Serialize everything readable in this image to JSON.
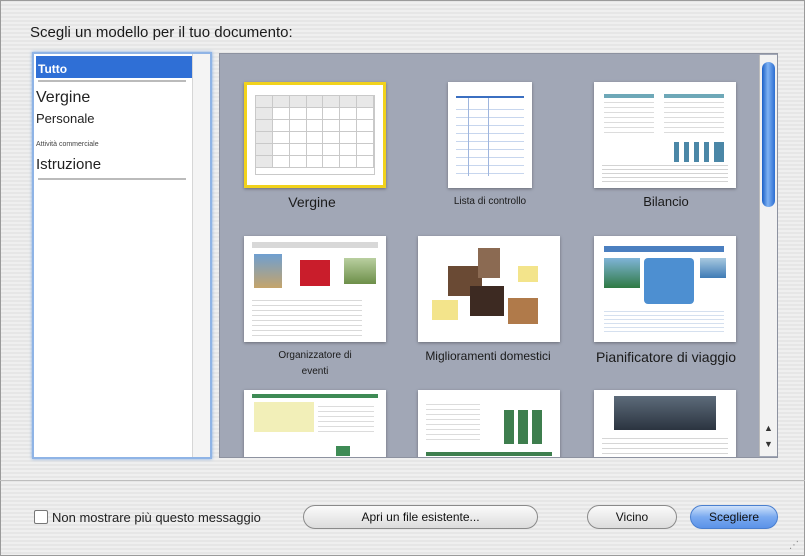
{
  "dialog": {
    "prompt": "Scegli un modello per il tuo documento:"
  },
  "sidebar": {
    "items": [
      {
        "label": "Tutto"
      },
      {
        "label": "Vergine"
      },
      {
        "label": "Personale"
      },
      {
        "label": "Attività commerciale"
      },
      {
        "label": "Istruzione"
      }
    ]
  },
  "templates": [
    {
      "label": "Vergine"
    },
    {
      "label": "Lista di controllo"
    },
    {
      "label": "Bilancio"
    },
    {
      "label": "Organizzatore di"
    },
    {
      "label": "eventi"
    },
    {
      "label": "Miglioramenti domestici"
    },
    {
      "label": "Pianificatore di viaggio"
    }
  ],
  "footer": {
    "checkbox_label": "Non mostrare più questo messaggio",
    "open_label": "Apri un file esistente...",
    "close_label": "Vicino",
    "choose_label": "Scegliere"
  },
  "colors": {
    "selection": "#2f6fd6",
    "accent_yellow": "#f1d21c",
    "grid_bg": "#a1a7b6"
  }
}
